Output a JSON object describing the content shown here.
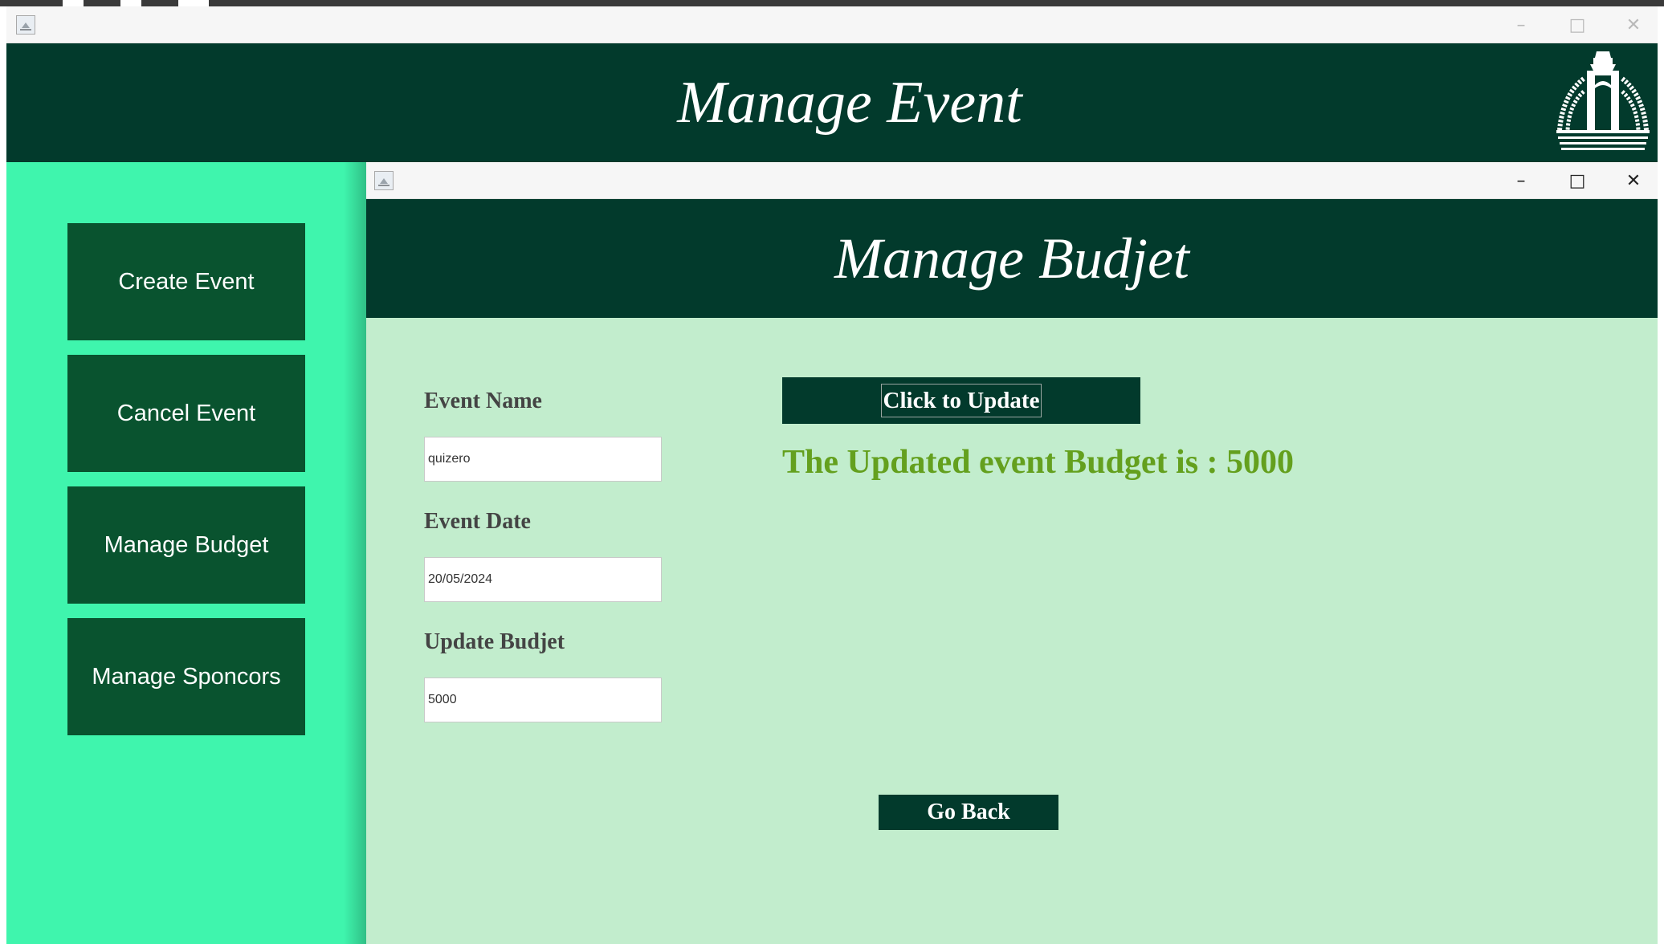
{
  "outer_window": {
    "title": "Manage Event",
    "controls": {
      "minimize": "–",
      "maximize": "□",
      "close": "✕"
    }
  },
  "sidebar": {
    "buttons": [
      {
        "label": "Create Event"
      },
      {
        "label": "Cancel Event"
      },
      {
        "label": "Manage Budget"
      },
      {
        "label": "Manage Sponcors"
      }
    ]
  },
  "inner_window": {
    "title": "Manage Budjet",
    "controls": {
      "minimize": "–",
      "maximize": "□",
      "close": "✕"
    },
    "form": {
      "event_name": {
        "label": "Event Name",
        "value": "quizero"
      },
      "event_date": {
        "label": "Event Date",
        "value": "20/05/2024"
      },
      "update_budget": {
        "label": "Update Budjet",
        "value": "5000"
      }
    },
    "update_button": "Click to Update",
    "result_message": "The Updated event Budget is : 5000",
    "back_button": "Go Back"
  },
  "colors": {
    "header": "#023a2c",
    "sidebar": "#3ff5ad",
    "sidebar_button": "#09532f",
    "body": "#c2edcd",
    "result_text": "#64a01e"
  }
}
